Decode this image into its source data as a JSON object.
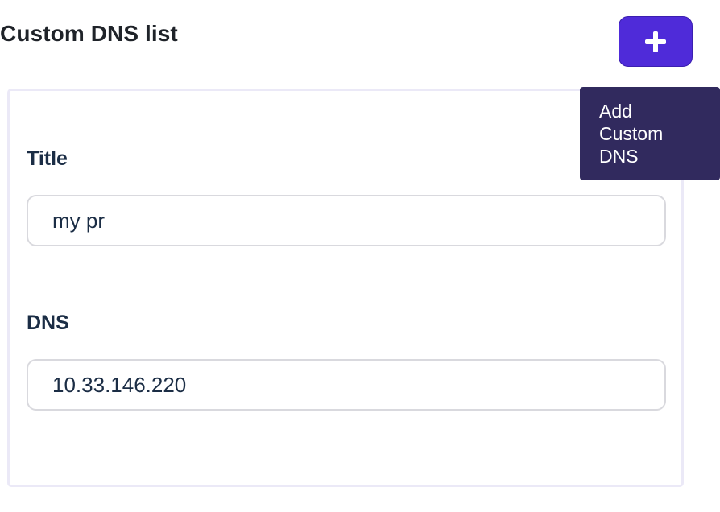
{
  "header": {
    "title": "Custom DNS list",
    "add_button_icon": "plus-icon",
    "tooltip": "Add\nCustom\nDNS"
  },
  "form": {
    "title_label": "Title",
    "title_value": "my pr",
    "dns_label": "DNS",
    "dns_value": "10.33.146.220"
  },
  "colors": {
    "accent": "#4f2bd9",
    "tooltip_bg": "#312a5e",
    "label_text": "#1b2d45",
    "card_border": "#ebe9f7",
    "input_border": "#d9d9de"
  }
}
